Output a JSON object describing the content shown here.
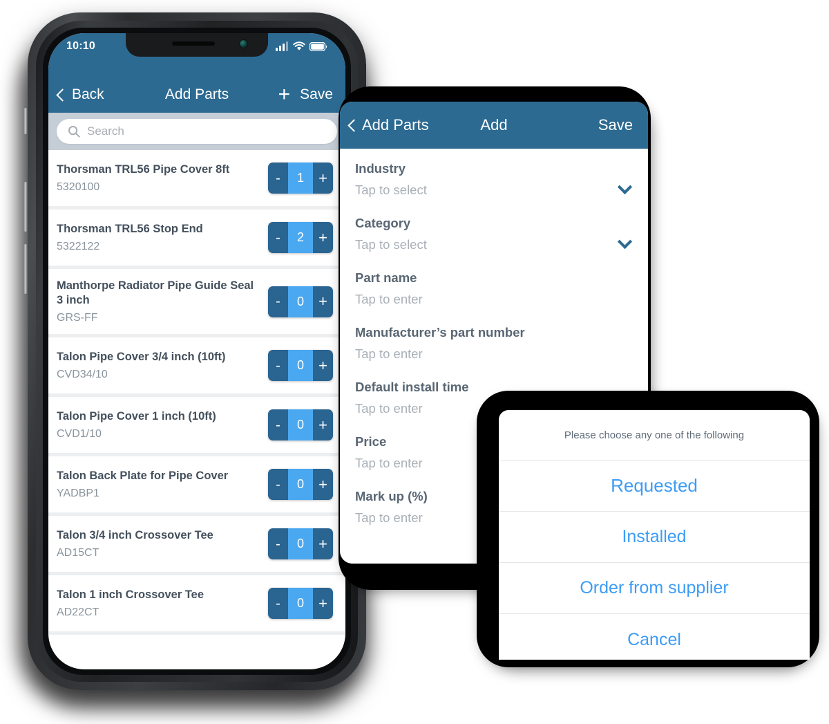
{
  "phone1": {
    "status_bar": {
      "time": "10:10",
      "cellular_icon": "signal-bars-icon",
      "wifi_icon": "wifi-icon",
      "battery_icon": "battery-icon"
    },
    "navbar": {
      "back_label": "Back",
      "title": "Add Parts",
      "add_icon": "plus-icon",
      "save_label": "Save"
    },
    "search": {
      "icon": "search-icon",
      "placeholder": "Search",
      "value": ""
    },
    "parts": [
      {
        "name": "Thorsman TRL56 Pipe Cover 8ft",
        "code": "5320100",
        "qty": "1",
        "minus": "-",
        "plus": "+"
      },
      {
        "name": "Thorsman TRL56 Stop End",
        "code": "5322122",
        "qty": "2",
        "minus": "-",
        "plus": "+"
      },
      {
        "name": "Manthorpe Radiator Pipe Guide Seal 3 inch",
        "code": "GRS-FF",
        "qty": "0",
        "minus": "-",
        "plus": "+"
      },
      {
        "name": "Talon Pipe Cover 3/4 inch (10ft)",
        "code": "CVD34/10",
        "qty": "0",
        "minus": "-",
        "plus": "+"
      },
      {
        "name": "Talon Pipe Cover 1 inch (10ft)",
        "code": "CVD1/10",
        "qty": "0",
        "minus": "-",
        "plus": "+"
      },
      {
        "name": "Talon Back Plate for Pipe Cover",
        "code": "YADBP1",
        "qty": "0",
        "minus": "-",
        "plus": "+"
      },
      {
        "name": "Talon 3/4 inch Crossover Tee",
        "code": "AD15CT",
        "qty": "0",
        "minus": "-",
        "plus": "+"
      },
      {
        "name": "Talon 1 inch Crossover Tee",
        "code": "AD22CT",
        "qty": "0",
        "minus": "-",
        "plus": "+"
      }
    ]
  },
  "phone2": {
    "navbar": {
      "back_label": "Add Parts",
      "title": "Add",
      "save_label": "Save"
    },
    "fields": [
      {
        "label": "Industry",
        "value": "Tap to select",
        "control": "chevron-down-icon"
      },
      {
        "label": "Category",
        "value": "Tap to select",
        "control": "chevron-down-icon"
      },
      {
        "label": "Part name",
        "value": "Tap to enter",
        "control": ""
      },
      {
        "label": "Manufacturer’s part number",
        "value": "Tap to enter",
        "control": ""
      },
      {
        "label": "Default install time",
        "value": "Tap to enter",
        "control": ""
      },
      {
        "label": "Price",
        "value": "Tap to enter",
        "control": ""
      },
      {
        "label": "Mark up (%)",
        "value": "Tap to enter",
        "control": ""
      }
    ]
  },
  "phone3": {
    "action_sheet": {
      "title": "Please choose any one of the following",
      "options": [
        {
          "label": "Requested"
        },
        {
          "label": "Installed"
        },
        {
          "label": "Order from supplier"
        },
        {
          "label": "Cancel"
        }
      ]
    }
  },
  "colors": {
    "header_blue": "#2c6a92",
    "stepper_dark": "#2a6491",
    "stepper_light": "#4aa8f0",
    "link_blue": "#3d9cf5",
    "search_bg": "#c5ced7",
    "list_divider": "#eceef0",
    "text_dark": "#44505c",
    "text_muted": "#8a949d"
  }
}
